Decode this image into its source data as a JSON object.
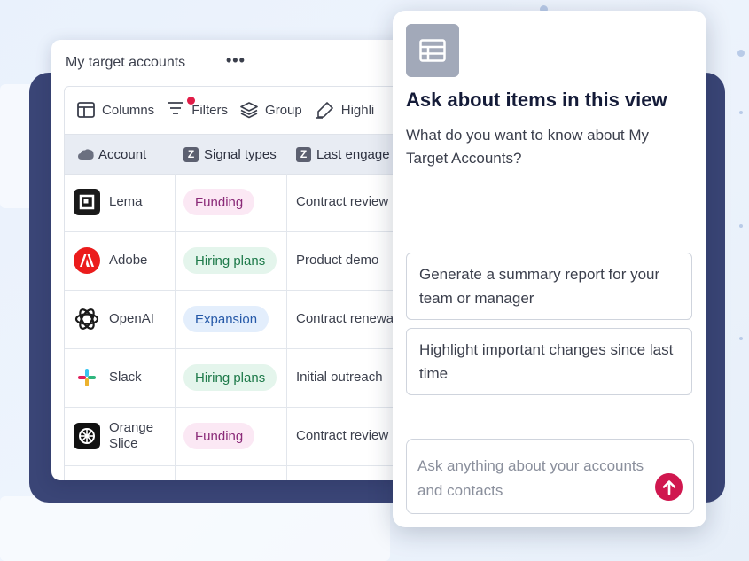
{
  "table_card": {
    "title": "My target accounts",
    "more": "•••",
    "toolbar": {
      "columns": "Columns",
      "filters": "Filters",
      "group": "Group",
      "highlight": "Highli"
    },
    "headers": {
      "account": "Account",
      "signal_types": "Signal types",
      "last_engagement": "Last engage"
    },
    "rows": [
      {
        "account": "Lema",
        "signal": "Funding",
        "engagement": "Contract review"
      },
      {
        "account": "Adobe",
        "signal": "Hiring plans",
        "engagement": "Product demo"
      },
      {
        "account": "OpenAI",
        "signal": "Expansion",
        "engagement": "Contract renewal"
      },
      {
        "account": "Slack",
        "signal": "Hiring plans",
        "engagement": "Initial outreach"
      },
      {
        "account": "Orange Slice",
        "signal": "Funding",
        "engagement": "Contract review"
      }
    ]
  },
  "panel": {
    "title": "Ask about items in this view",
    "subtitle": "What do you want to know about My Target Accounts?",
    "suggestions": [
      "Generate a summary report for your team or manager",
      "Highlight important changes since last time"
    ],
    "input_placeholder": "Ask anything about your accounts and contacts"
  },
  "colors": {
    "navy_frame": "#3a4576",
    "accent_send": "#d0174f",
    "funding_pill_bg": "#fbe8f4",
    "funding_pill_text": "#8a2a78",
    "hiring_pill_bg": "#e4f5ec",
    "hiring_pill_text": "#1e7a4a",
    "expansion_pill_bg": "#e3eefc",
    "expansion_pill_text": "#2559a8"
  }
}
